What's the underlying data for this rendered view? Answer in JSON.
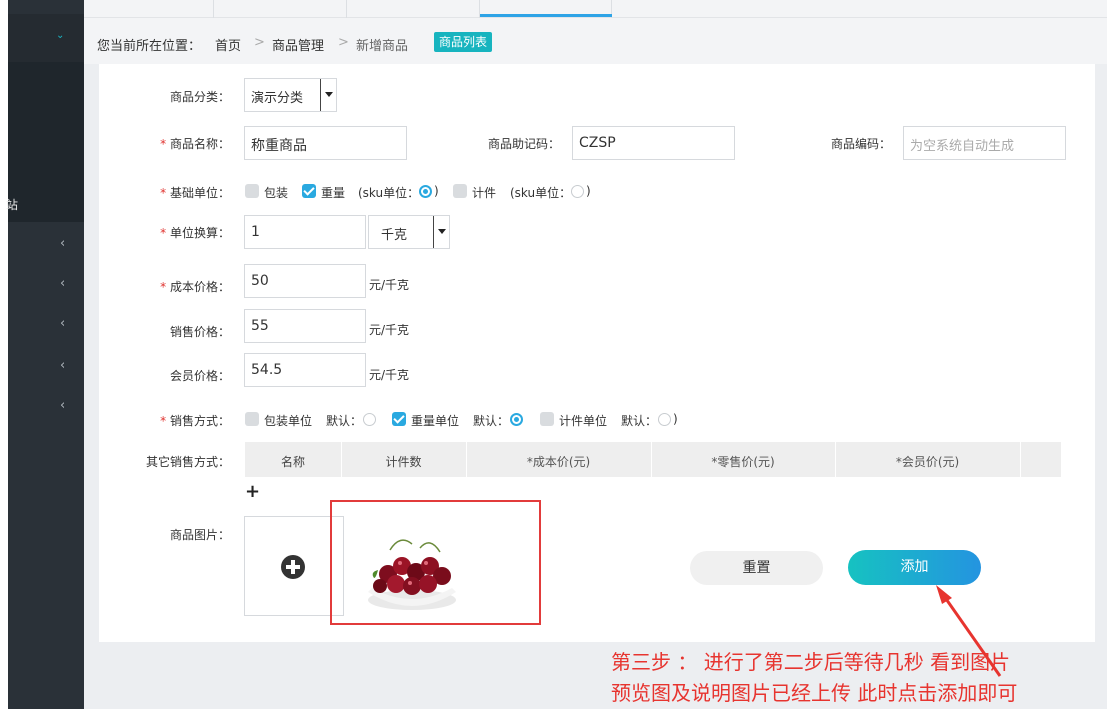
{
  "sidebar": {
    "truncated_label": "站",
    "collapse_count": 5
  },
  "breadcrumb": {
    "prefix": "您当前所在位置：",
    "items": [
      "首页",
      "商品管理",
      "新增商品"
    ],
    "separator": ">",
    "tag": "商品列表"
  },
  "form": {
    "category": {
      "label": "商品分类：",
      "value": "演示分类"
    },
    "name": {
      "label": "商品名称：",
      "value": "称重商品"
    },
    "mnemonic": {
      "label": "商品助记码：",
      "value": "CZSP"
    },
    "code": {
      "label": "商品编码：",
      "placeholder": "为空系统自动生成"
    },
    "base_unit": {
      "label": "基础单位：",
      "opt_pack": "包装",
      "opt_weight": "重量",
      "sku_weight": "(sku单位：",
      "opt_piece": "计件",
      "sku_piece": "(sku单位：",
      "close": ")"
    },
    "conversion": {
      "label": "单位换算：",
      "value": "1",
      "unit": "千克"
    },
    "cost_price": {
      "label": "成本价格：",
      "value": "50",
      "unit": "元/千克"
    },
    "sale_price": {
      "label": "销售价格：",
      "value": "55",
      "unit": "元/千克"
    },
    "member_price": {
      "label": "会员价格：",
      "value": "54.5",
      "unit": "元/千克"
    },
    "sale_method": {
      "label": "销售方式：",
      "opt_pack": "包装单位",
      "default1": "默认：",
      "opt_weight": "重量单位",
      "default2": "默认：",
      "opt_piece": "计件单位",
      "default3": "默认：",
      "close": ")"
    },
    "other_methods": {
      "label": "其它销售方式：",
      "columns": [
        "名称",
        "计件数",
        "*成本价(元)",
        "*零售价(元)",
        "*会员价(元)"
      ]
    },
    "image": {
      "label": "商品图片："
    }
  },
  "buttons": {
    "reset": "重置",
    "add": "添加"
  },
  "annotation": {
    "line1": "第三步 ：  进行了第二步后等待几秒 看到图片",
    "line2": "预览图及说明图片已经上传 此时点击添加即可"
  },
  "colors": {
    "accent": "#17b4bf",
    "required": "#e0332f",
    "note": "#e7342f",
    "sidebar": "#2a3138"
  }
}
